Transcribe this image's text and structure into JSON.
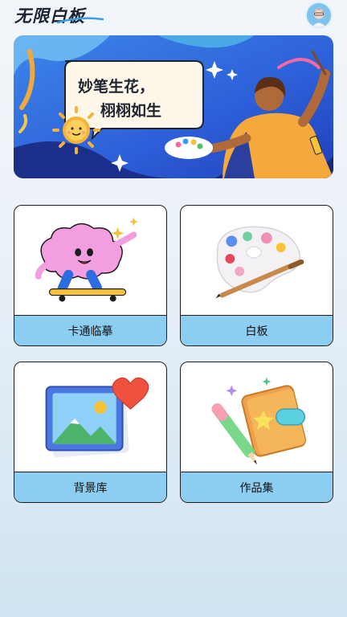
{
  "header": {
    "title": "无限白板",
    "avatar_icon": "user-avatar-icon"
  },
  "banner": {
    "line1": "妙笔生花，",
    "line2": "栩栩如生"
  },
  "cards": [
    {
      "label": "卡通临摹",
      "icon": "cartoon-cloud-skateboard-icon"
    },
    {
      "label": "白板",
      "icon": "paint-palette-brush-icon"
    },
    {
      "label": "背景库",
      "icon": "picture-gallery-heart-icon"
    },
    {
      "label": "作品集",
      "icon": "notebook-pencil-icon"
    }
  ],
  "colors": {
    "card_label_bg": "#8ccdf2",
    "banner_bg": "#2f6be0",
    "accent_yellow": "#f5c23a"
  }
}
